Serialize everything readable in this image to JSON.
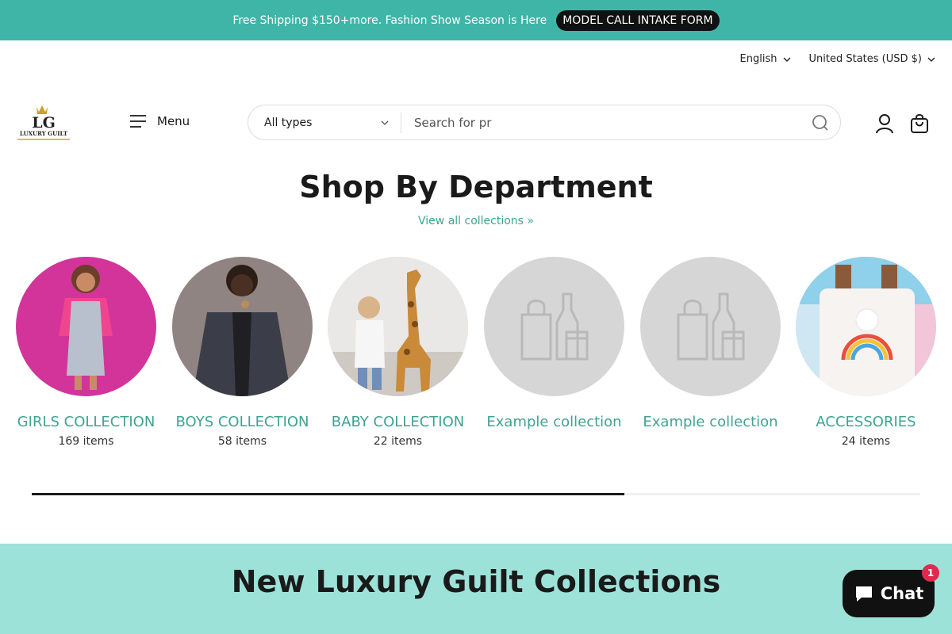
{
  "announcement": {
    "text": "Free Shipping $150+more. Fashion Show Season is Here",
    "cta_label": "MODEL CALL INTAKE FORM"
  },
  "locale": {
    "language": "English",
    "country": "United States (USD $)"
  },
  "header": {
    "logo_text": "LG",
    "logo_subtext": "LUXURY GUILT",
    "menu_label": "Menu",
    "search_type": "All types",
    "search_placeholder": "Search for pr"
  },
  "department": {
    "title": "Shop By Department",
    "view_all": "View all collections »",
    "collections": [
      {
        "name": "GIRLS COLLECTION",
        "count": "169 items",
        "image": "photo-girl-pink-jacket"
      },
      {
        "name": "BOYS COLLECTION",
        "count": "58 items",
        "image": "photo-boy-denim-jacket"
      },
      {
        "name": "BABY COLLECTION",
        "count": "22 items",
        "image": "photo-toddler-giraffe"
      },
      {
        "name": "Example collection",
        "count": "",
        "image": "placeholder-bag-icon"
      },
      {
        "name": "Example collection",
        "count": "",
        "image": "placeholder-bag-icon"
      },
      {
        "name": "ACCESSORIES",
        "count": "24 items",
        "image": "photo-rainbow-bag"
      }
    ],
    "scroll_progress": 0.667
  },
  "new_collections": {
    "title": "New Luxury Guilt Collections"
  },
  "chat": {
    "label": "Chat",
    "badge": "1"
  },
  "colors": {
    "accent": "#3fb5a8",
    "link": "#3fa393",
    "band": "#9de2d9",
    "dark": "#111111",
    "badge": "#e0294f"
  }
}
